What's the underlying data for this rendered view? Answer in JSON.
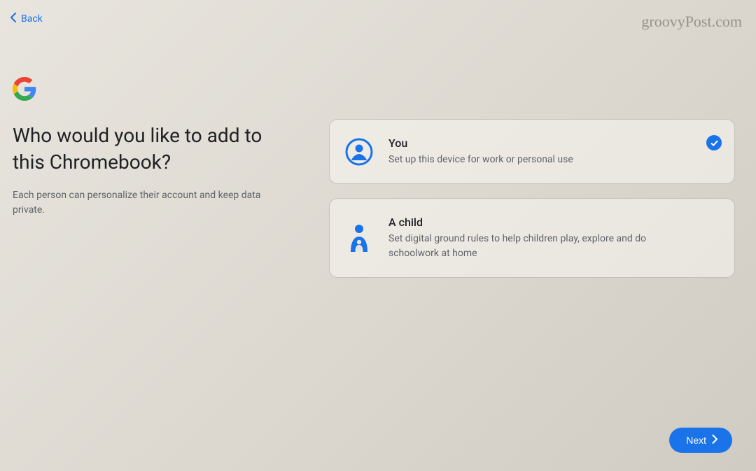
{
  "header": {
    "back_label": "Back"
  },
  "watermark": "groovyPost.com",
  "heading": "Who would you like to add to this Chromebook?",
  "subheading": "Each person can personalize their account and keep data private.",
  "options": [
    {
      "title": "You",
      "description": "Set up this device for work or personal use",
      "selected": true,
      "icon": "person-circle-icon"
    },
    {
      "title": "A child",
      "description": "Set digital ground rules to help children play, explore and do schoolwork at home",
      "selected": false,
      "icon": "family-icon"
    }
  ],
  "footer": {
    "next_label": "Next"
  }
}
